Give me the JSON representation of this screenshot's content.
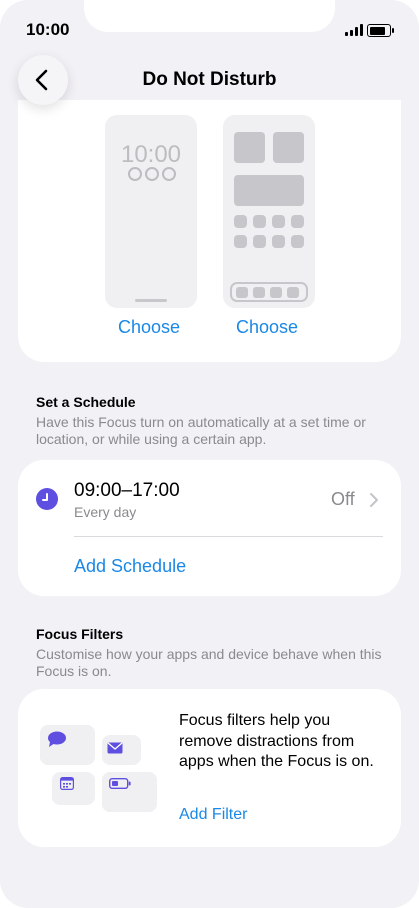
{
  "status": {
    "time": "10:00"
  },
  "nav": {
    "title": "Do Not Disturb"
  },
  "screens": {
    "lock_time": "10:00",
    "choose_lock": "Choose",
    "choose_home": "Choose"
  },
  "schedule_section": {
    "title": "Set a Schedule",
    "description": "Have this Focus turn on automatically at a set time or location, or while using a certain app."
  },
  "schedule": {
    "time": "09:00–17:00",
    "days": "Every day",
    "status": "Off",
    "add_label": "Add Schedule"
  },
  "filters_section": {
    "title": "Focus Filters",
    "description": "Customise how your apps and device behave when this Focus is on."
  },
  "filters": {
    "text": "Focus filters help you remove distractions from apps when the Focus is on.",
    "add_label": "Add Filter"
  },
  "colors": {
    "accent": "#1a88e6",
    "focus_purple": "#5e4fe0",
    "background": "#f2f1f6"
  }
}
